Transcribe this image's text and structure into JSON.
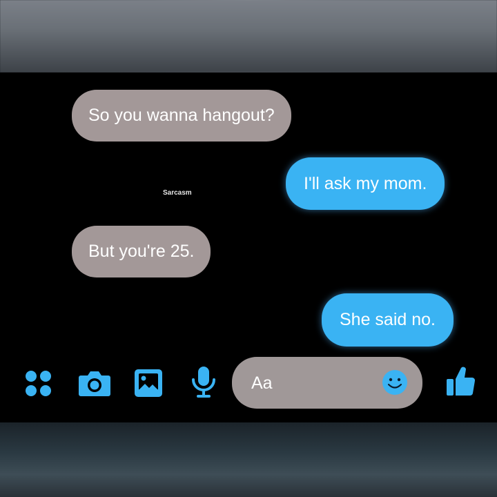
{
  "conversation": {
    "watermark": "Sarcasm",
    "messages": [
      {
        "direction": "received",
        "text": "So you wanna hangout?"
      },
      {
        "direction": "sent",
        "text": "I'll ask my mom."
      },
      {
        "direction": "received",
        "text": "But you're 25."
      },
      {
        "direction": "sent",
        "text": "She said no."
      }
    ]
  },
  "composer": {
    "placeholder": "Aa"
  },
  "toolbar": {
    "icons": [
      "apps-icon",
      "camera-icon",
      "gallery-icon",
      "microphone-icon",
      "emoji-icon",
      "thumbs-up-icon"
    ]
  },
  "colors": {
    "accent": "#3ab3f3",
    "received_bubble": "#a39898",
    "background": "#000000"
  }
}
